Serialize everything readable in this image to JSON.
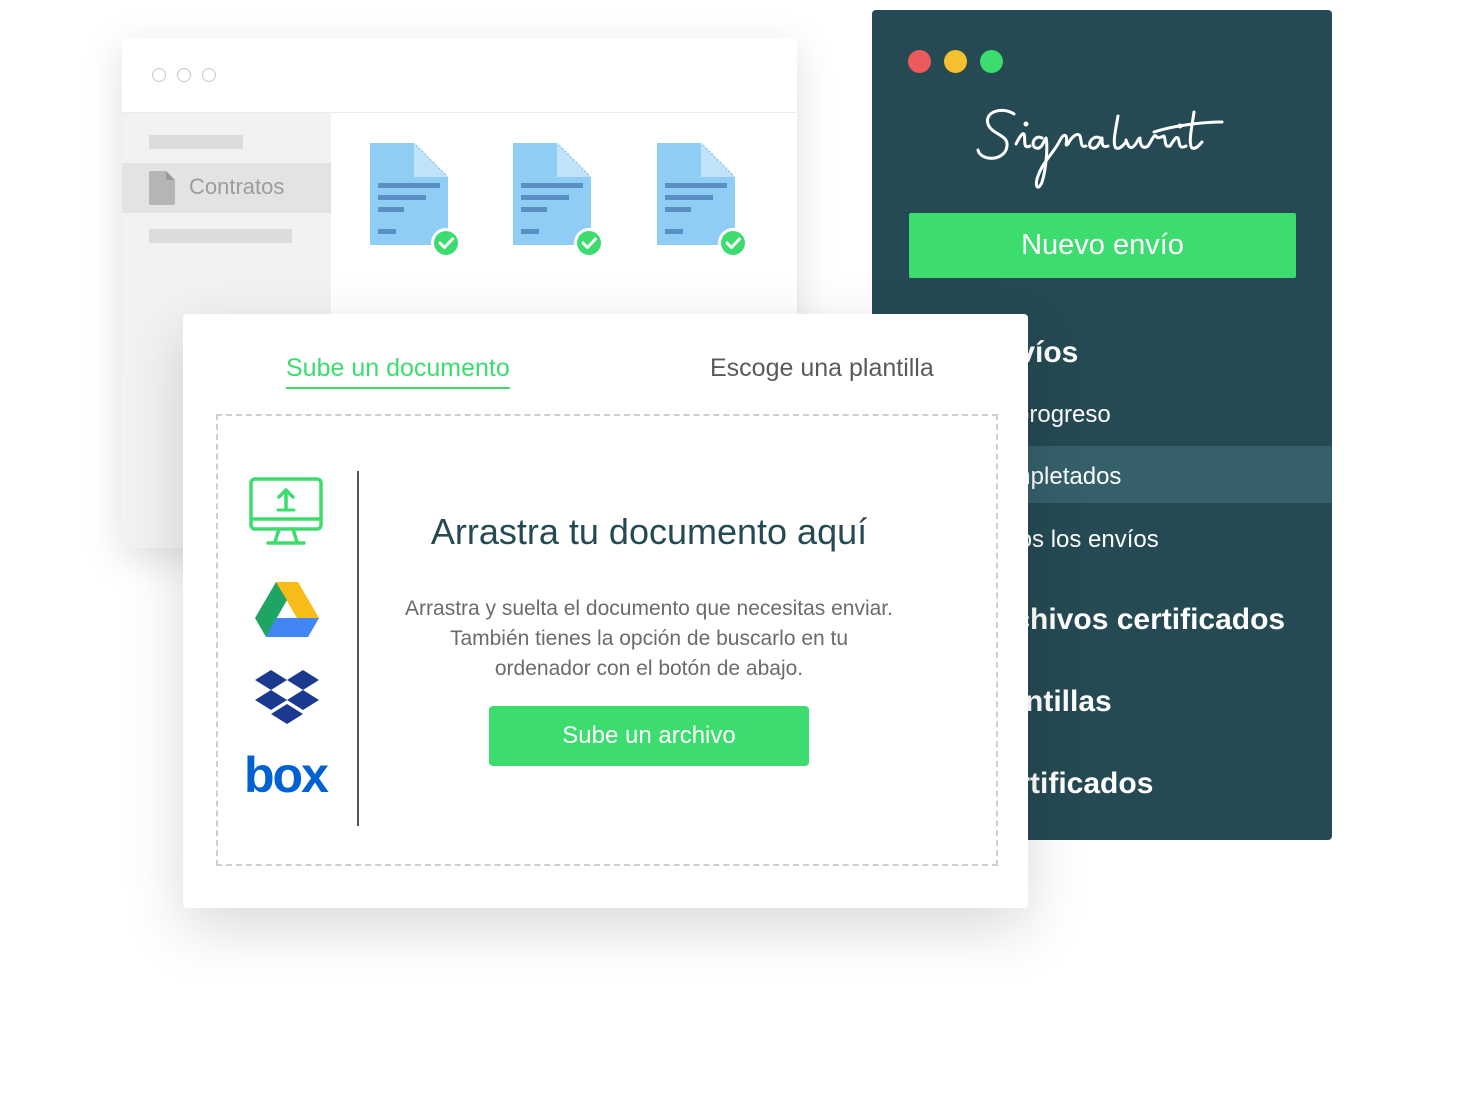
{
  "file_window": {
    "sidebar_active_label": "Contratos",
    "documents": [
      {
        "icon": "document-icon",
        "status": "check-icon"
      },
      {
        "icon": "document-icon",
        "status": "check-icon"
      },
      {
        "icon": "document-icon",
        "status": "check-icon"
      }
    ]
  },
  "app_window": {
    "logo_text": "Signaturit",
    "new_button": "Nuevo envío",
    "nav": [
      {
        "label": "Envíos",
        "level": "head"
      },
      {
        "label": "En progreso",
        "level": "sub"
      },
      {
        "label": "Completados",
        "level": "sub",
        "selected": true
      },
      {
        "label": "Todos los envíos",
        "level": "sub"
      },
      {
        "label": "Archivos certificados",
        "level": "head"
      },
      {
        "label": "Plantillas",
        "level": "head"
      },
      {
        "label": "Certificados",
        "level": "head"
      }
    ]
  },
  "upload_dialog": {
    "tabs": [
      "Sube un documento",
      "Escoge una plantilla"
    ],
    "active_tab": "Sube un documento",
    "providers": [
      "computer-upload-icon",
      "google-drive-icon",
      "dropbox-icon",
      "box-icon"
    ],
    "box_logo_text": "box",
    "title": "Arrastra tu documento aquí",
    "description": "Arrastra y suelta el documento que necesitas enviar. También tienes la opción de buscarlo en tu ordenador con el botón de abajo.",
    "button": "Sube un archivo"
  },
  "colors": {
    "accent": "#3ddc6f",
    "app_bg": "#254a53",
    "doc_blue": "#8fcdf4"
  }
}
